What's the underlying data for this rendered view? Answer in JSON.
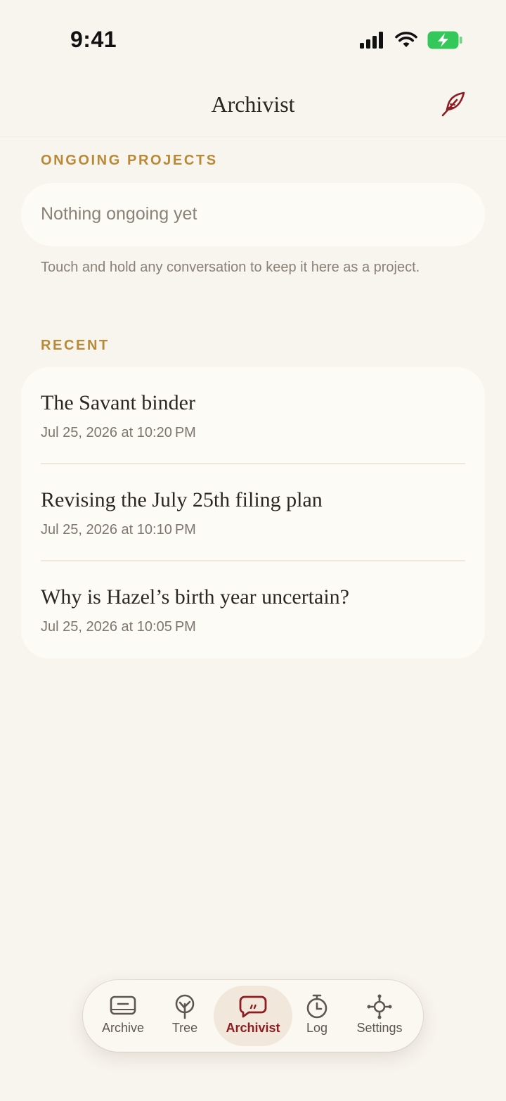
{
  "status_bar": {
    "time": "9:41"
  },
  "header": {
    "title": "Archivist"
  },
  "ongoing": {
    "label": "ONGOING PROJECTS",
    "empty_text": "Nothing ongoing yet",
    "hint": "Touch and hold any conversation to keep it here as a project."
  },
  "recent": {
    "label": "RECENT",
    "items": [
      {
        "title": "The Savant binder",
        "date": "Jul 25, 2026 at 10:20 PM"
      },
      {
        "title": "Revising the July 25th filing plan",
        "date": "Jul 25, 2026 at 10:10 PM"
      },
      {
        "title": "Why is Hazel’s birth year uncertain?",
        "date": "Jul 25, 2026 at 10:05 PM"
      }
    ]
  },
  "tabs": [
    {
      "label": "Archive",
      "icon": "archive-icon"
    },
    {
      "label": "Tree",
      "icon": "tree-icon"
    },
    {
      "label": "Archivist",
      "icon": "chat-bubble-icon",
      "active": true
    },
    {
      "label": "Log",
      "icon": "stopwatch-icon"
    },
    {
      "label": "Settings",
      "icon": "settings-icon"
    }
  ],
  "colors": {
    "accent": "#8e1d22",
    "section_label": "#b88a38",
    "background": "#f8f4ee",
    "card": "#fdfbf6",
    "battery": "#34c759"
  }
}
